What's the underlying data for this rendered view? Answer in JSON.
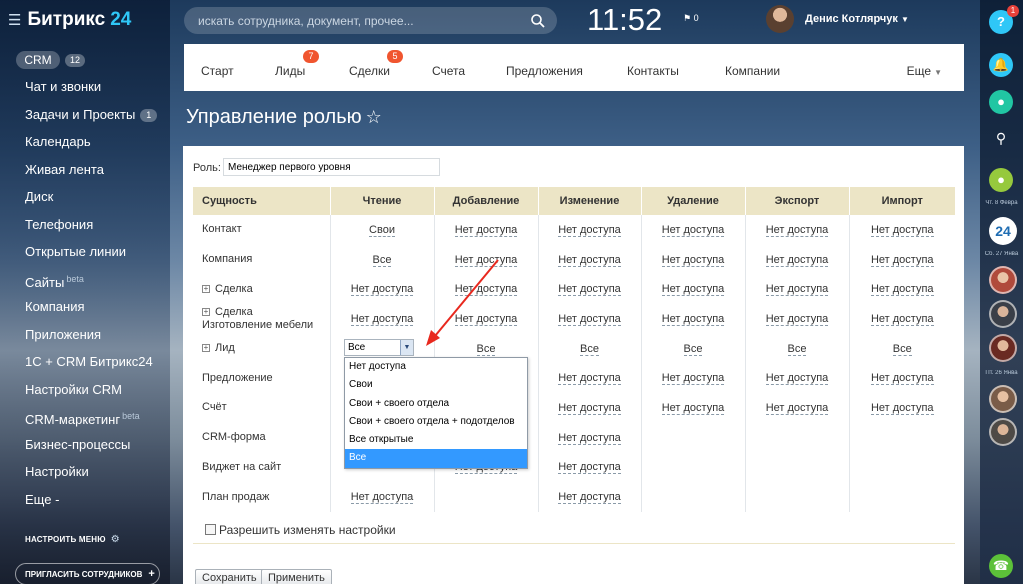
{
  "logo": {
    "text": "Битрикс",
    "num": "24"
  },
  "sidebar": {
    "crm_label": "CRM",
    "crm_count": "12",
    "items": [
      {
        "label": "Чат и звонки"
      },
      {
        "label": "Задачи и Проекты",
        "badge": "1"
      },
      {
        "label": "Календарь"
      },
      {
        "label": "Живая лента"
      },
      {
        "label": "Диск"
      },
      {
        "label": "Телефония"
      },
      {
        "label": "Открытые линии"
      },
      {
        "label": "Сайты",
        "beta": "beta"
      },
      {
        "label": "Компания"
      },
      {
        "label": "Приложения"
      },
      {
        "label": "1С + CRM Битрикс24"
      },
      {
        "label": "Настройки CRM"
      },
      {
        "label": "CRM-маркетинг",
        "beta": "beta"
      },
      {
        "label": "Бизнес-процессы"
      },
      {
        "label": "Настройки"
      },
      {
        "label": "Еще -"
      }
    ],
    "setup_menu": "НАСТРОИТЬ МЕНЮ",
    "invite": "ПРИГЛАСИТЬ СОТРУДНИКОВ"
  },
  "header": {
    "search_placeholder": "искать сотрудника, документ, прочее...",
    "clock": "11:52",
    "flag_count": "0",
    "user_name": "Денис Котлярчук"
  },
  "rightbar": {
    "help_badge": "1",
    "date1": "Чт. 8 Февра",
    "date2": "Сб. 27 Янва",
    "date3": "Пт. 26 Янва",
    "logo24": "24"
  },
  "tabs": [
    {
      "label": "Старт"
    },
    {
      "label": "Лиды",
      "count": "7"
    },
    {
      "label": "Сделки",
      "count": "5"
    },
    {
      "label": "Счета"
    },
    {
      "label": "Предложения"
    },
    {
      "label": "Контакты"
    },
    {
      "label": "Компании"
    }
  ],
  "tab_more": "Еще",
  "page_title": "Управление ролью",
  "role": {
    "label": "Роль:",
    "value": "Менеджер первого уровня"
  },
  "table": {
    "headers": [
      "Сущность",
      "Чтение",
      "Добавление",
      "Изменение",
      "Удаление",
      "Экспорт",
      "Импорт"
    ],
    "rows": [
      {
        "entity": "Контакт",
        "values": [
          "Свои",
          "Нет доступа",
          "Нет доступа",
          "Нет доступа",
          "Нет доступа",
          "Нет доступа"
        ]
      },
      {
        "entity": "Компания",
        "values": [
          "Все",
          "Нет доступа",
          "Нет доступа",
          "Нет доступа",
          "Нет доступа",
          "Нет доступа"
        ]
      },
      {
        "entity": "Сделка",
        "expandable": true,
        "values": [
          "Нет доступа",
          "Нет доступа",
          "Нет доступа",
          "Нет доступа",
          "Нет доступа",
          "Нет доступа"
        ]
      },
      {
        "entity": "Сделка",
        "entity2": "Изготовление мебели",
        "expandable": true,
        "values": [
          "Нет доступа",
          "Нет доступа",
          "Нет доступа",
          "Нет доступа",
          "Нет доступа",
          "Нет доступа"
        ]
      },
      {
        "entity": "Лид",
        "expandable": true,
        "values": [
          "",
          "Все",
          "Все",
          "Все",
          "Все",
          "Все"
        ]
      },
      {
        "entity": "Предложение",
        "values": [
          "",
          "",
          "Нет доступа",
          "Нет доступа",
          "Нет доступа",
          "Нет доступа"
        ]
      },
      {
        "entity": "Счёт",
        "values": [
          "",
          "",
          "Нет доступа",
          "Нет доступа",
          "Нет доступа",
          "Нет доступа"
        ]
      },
      {
        "entity": "CRM-форма",
        "values": [
          "",
          "",
          "Нет доступа",
          "",
          "",
          ""
        ]
      },
      {
        "entity": "Виджет на сайт",
        "values": [
          "",
          "Нет доступа",
          "Нет доступа",
          "",
          "",
          ""
        ]
      },
      {
        "entity": "План продаж",
        "values": [
          "Нет доступа",
          "",
          "Нет доступа",
          "",
          "",
          ""
        ]
      }
    ]
  },
  "select": {
    "value": "Все",
    "options": [
      "Нет доступа",
      "Свои",
      "Свои + своего отдела",
      "Свои + своего отдела + подотделов",
      "Все открытые",
      "Все"
    ],
    "selected_index": 5
  },
  "allow_label": "Разрешить изменять настройки",
  "buttons": {
    "save": "Сохранить",
    "apply": "Применить"
  },
  "colors": {
    "accent": "#2fc7f7",
    "header_row": "#ece5c6",
    "dropdown_selected": "#3399ff",
    "badge": "#f0552f",
    "arrow": "#e8281e"
  }
}
